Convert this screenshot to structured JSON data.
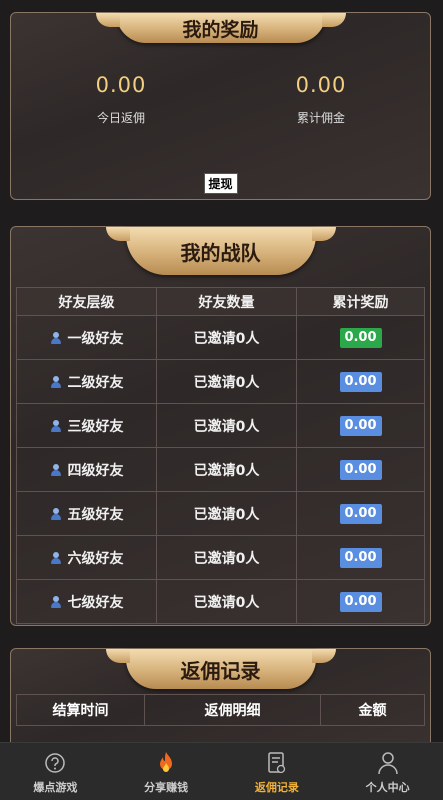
{
  "rewards": {
    "title": "我的奖励",
    "today": {
      "value": "0.00",
      "label": "今日返佣"
    },
    "total": {
      "value": "0.00",
      "label": "累计佣金"
    },
    "withdraw_label": "提现"
  },
  "team": {
    "title": "我的战队",
    "columns": [
      "好友层级",
      "好友数量",
      "累计奖励"
    ],
    "rows": [
      {
        "level": "一级好友",
        "count": "已邀请0人",
        "reward": "0.00",
        "reward_color": "#2aa84a"
      },
      {
        "level": "二级好友",
        "count": "已邀请0人",
        "reward": "0.00",
        "reward_color": "#5a8ee0"
      },
      {
        "level": "三级好友",
        "count": "已邀请0人",
        "reward": "0.00",
        "reward_color": "#5a8ee0"
      },
      {
        "level": "四级好友",
        "count": "已邀请0人",
        "reward": "0.00",
        "reward_color": "#5a8ee0"
      },
      {
        "level": "五级好友",
        "count": "已邀请0人",
        "reward": "0.00",
        "reward_color": "#5a8ee0"
      },
      {
        "level": "六级好友",
        "count": "已邀请0人",
        "reward": "0.00",
        "reward_color": "#5a8ee0"
      },
      {
        "level": "七级好友",
        "count": "已邀请0人",
        "reward": "0.00",
        "reward_color": "#5a8ee0"
      }
    ]
  },
  "records": {
    "title": "返佣记录",
    "columns": [
      "结算时间",
      "返佣明细",
      "金额"
    ]
  },
  "nav": {
    "items": [
      {
        "label": "爆点游戏",
        "icon": "help-circle-icon",
        "active": false
      },
      {
        "label": "分享赚钱",
        "icon": "flame-icon",
        "active": false
      },
      {
        "label": "返佣记录",
        "icon": "document-icon",
        "active": true
      },
      {
        "label": "个人中心",
        "icon": "user-icon",
        "active": false
      }
    ]
  }
}
